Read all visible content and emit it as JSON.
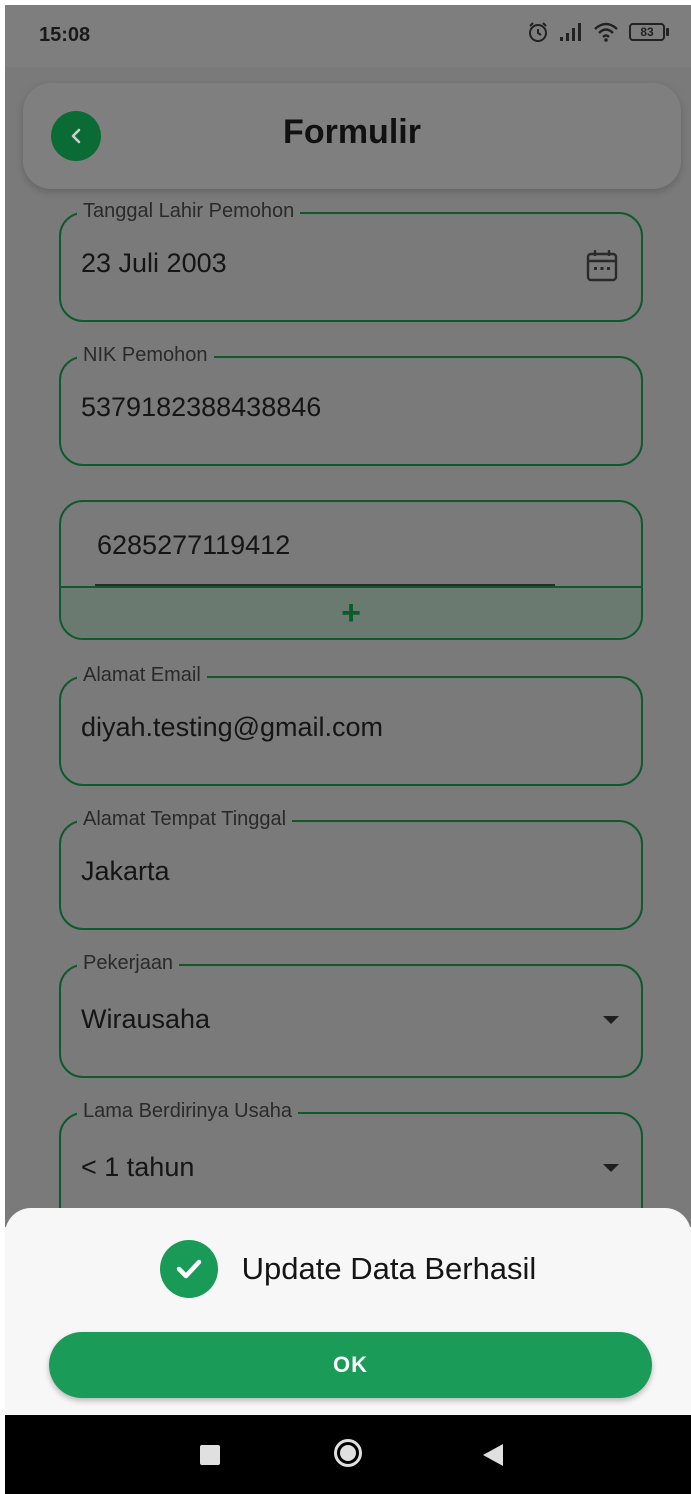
{
  "status_bar": {
    "time": "15:08",
    "battery": "83",
    "icons": [
      "alarm-icon",
      "signal-icon",
      "wifi-icon",
      "battery-icon"
    ]
  },
  "app_bar": {
    "title": "Formulir",
    "back_icon": "chevron-left-icon"
  },
  "form": {
    "birth_date": {
      "label": "Tanggal Lahir Pemohon",
      "value": "23 Juli 2003",
      "icon": "calendar-icon"
    },
    "nik": {
      "label": "NIK Pemohon",
      "value": "5379182388438846"
    },
    "phone": {
      "value": "6285277119412",
      "add_label": "+"
    },
    "email": {
      "label": "Alamat Email",
      "value": "diyah.testing@gmail.com"
    },
    "address": {
      "label": "Alamat Tempat Tinggal",
      "value": "Jakarta"
    },
    "occupation": {
      "label": "Pekerjaan",
      "value": "Wirausaha"
    },
    "business_age": {
      "label": "Lama Berdirinya Usaha",
      "value": "< 1 tahun"
    }
  },
  "dialog": {
    "message": "Update Data Berhasil",
    "ok_label": "OK",
    "icon": "check-circle-icon"
  },
  "nav_bar": {
    "icons": [
      "recents-icon",
      "home-icon",
      "back-icon"
    ]
  },
  "colors": {
    "primary_green": "#1a9b58",
    "dark_green": "#0b6b34",
    "overlay_gray": "#7a7a7a"
  }
}
